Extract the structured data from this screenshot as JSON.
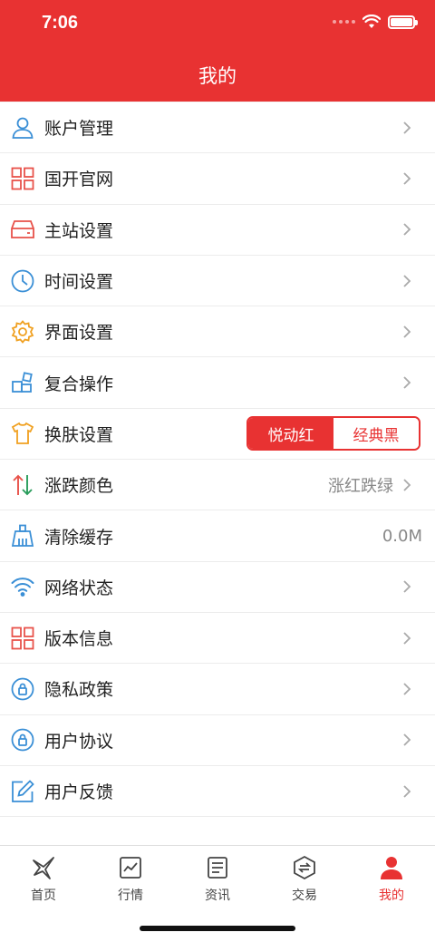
{
  "status": {
    "time": "7:06"
  },
  "header": {
    "title": "我的"
  },
  "menu": {
    "items": [
      {
        "label": "账户管理",
        "icon": "user-icon"
      },
      {
        "label": "国开官网",
        "icon": "grid-icon"
      },
      {
        "label": "主站设置",
        "icon": "server-icon"
      },
      {
        "label": "时间设置",
        "icon": "clock-icon"
      },
      {
        "label": "界面设置",
        "icon": "gear-icon"
      },
      {
        "label": "复合操作",
        "icon": "blocks-icon"
      },
      {
        "label": "换肤设置",
        "icon": "shirt-icon",
        "options": [
          "悦动红",
          "经典黑"
        ],
        "selected": "悦动红"
      },
      {
        "label": "涨跌颜色",
        "icon": "updown-icon",
        "value": "涨红跌绿"
      },
      {
        "label": "清除缓存",
        "icon": "broom-icon",
        "value": "0.0M"
      },
      {
        "label": "网络状态",
        "icon": "wifi-icon"
      },
      {
        "label": "版本信息",
        "icon": "grid-icon"
      },
      {
        "label": "隐私政策",
        "icon": "lock-icon"
      },
      {
        "label": "用户协议",
        "icon": "lock-icon"
      },
      {
        "label": "用户反馈",
        "icon": "edit-icon"
      }
    ]
  },
  "tabbar": {
    "items": [
      {
        "label": "首页",
        "icon": "home-icon"
      },
      {
        "label": "行情",
        "icon": "chart-icon"
      },
      {
        "label": "资讯",
        "icon": "news-icon"
      },
      {
        "label": "交易",
        "icon": "trade-icon"
      },
      {
        "label": "我的",
        "icon": "profile-icon",
        "active": true
      }
    ]
  },
  "colors": {
    "brand": "#e83232",
    "iconBlue": "#3a8fd6",
    "iconOrange": "#f0a020"
  }
}
